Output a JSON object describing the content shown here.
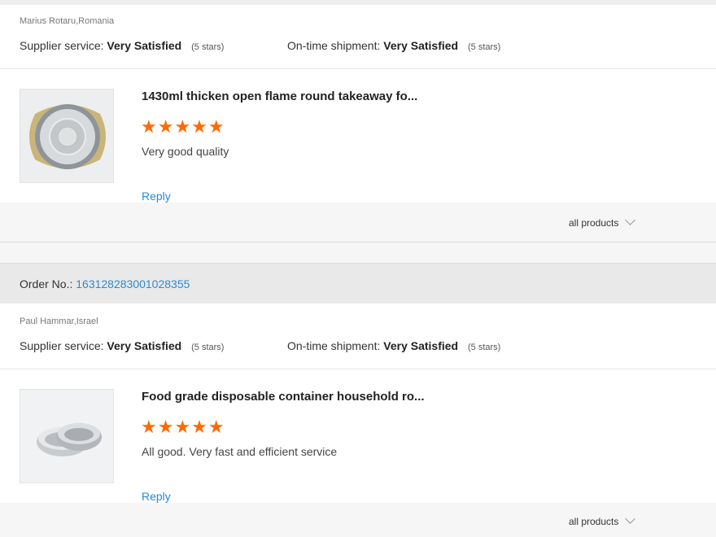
{
  "reviews": [
    {
      "order_label": "",
      "order_no": "",
      "reviewer": "Marius Rotaru,Romania",
      "supplier_label": "Supplier service:",
      "supplier_value": "Very Satisfied",
      "supplier_stars": "(5 stars)",
      "shipment_label": "On-time shipment:",
      "shipment_value": "Very Satisfied",
      "shipment_stars": "(5 stars)",
      "product_title": "1430ml thicken open flame round takeaway fo...",
      "stars": "★★★★★",
      "rating": 5,
      "comment": "Very good quality",
      "reply": "Reply",
      "all_products": "all products",
      "thumb_icon": "round-foil-container-image"
    },
    {
      "order_label": "Order No.:",
      "order_no": "163128283001028355",
      "reviewer": "Paul Hammar,Israel",
      "supplier_label": "Supplier service:",
      "supplier_value": "Very Satisfied",
      "supplier_stars": "(5 stars)",
      "shipment_label": "On-time shipment:",
      "shipment_value": "Very Satisfied",
      "shipment_stars": "(5 stars)",
      "product_title": "Food grade disposable container household ro...",
      "stars": "★★★★★",
      "rating": 5,
      "comment": "All good. Very fast and efficient service",
      "reply": "Reply",
      "all_products": "all products",
      "thumb_icon": "stacked-foil-cups-image"
    }
  ],
  "colors": {
    "accent_link": "#2a8ad4",
    "star": "#ff6a00",
    "footer_bg": "#f6f6f6",
    "order_bar_bg": "#e9e9e9"
  }
}
